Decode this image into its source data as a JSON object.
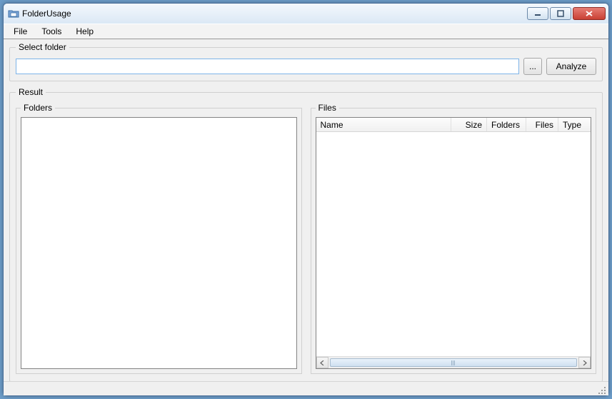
{
  "window": {
    "title": "FolderUsage"
  },
  "menu": {
    "file": "File",
    "tools": "Tools",
    "help": "Help"
  },
  "selectFolder": {
    "legend": "Select folder",
    "path": "",
    "placeholder": "",
    "browse_label": "...",
    "analyze_label": "Analyze"
  },
  "result": {
    "legend": "Result",
    "folders": {
      "legend": "Folders",
      "items": []
    },
    "files": {
      "legend": "Files",
      "columns": {
        "name": "Name",
        "size": "Size",
        "folders": "Folders",
        "files": "Files",
        "type": "Type"
      },
      "rows": []
    }
  }
}
